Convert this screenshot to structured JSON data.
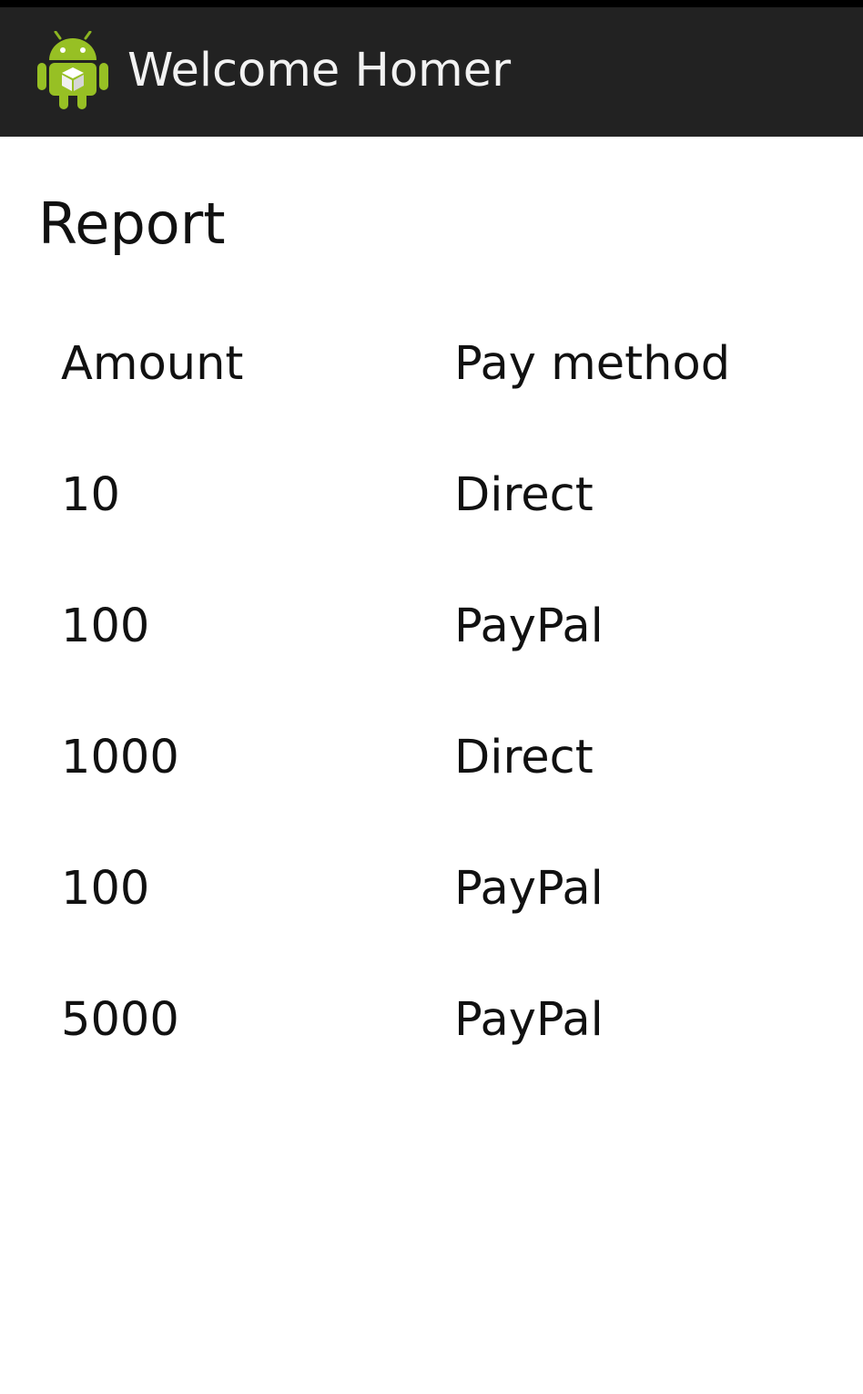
{
  "action_bar": {
    "title": "Welcome Homer",
    "icon": "android-robot-icon"
  },
  "page": {
    "title": "Report"
  },
  "table": {
    "headers": {
      "amount": "Amount",
      "method": "Pay method"
    },
    "rows": [
      {
        "amount": "10",
        "method": "Direct"
      },
      {
        "amount": "100",
        "method": "PayPal"
      },
      {
        "amount": "1000",
        "method": "Direct"
      },
      {
        "amount": "100",
        "method": "PayPal"
      },
      {
        "amount": "5000",
        "method": "PayPal"
      }
    ]
  },
  "colors": {
    "action_bar": "#222222",
    "android_green": "#97c024",
    "text": "#111111"
  }
}
